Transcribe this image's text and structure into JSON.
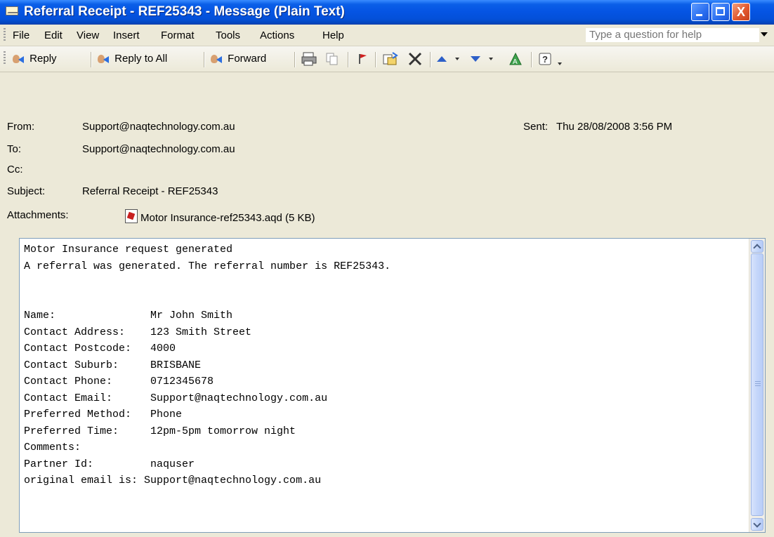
{
  "window": {
    "title": "Referral Receipt - REF25343 - Message (Plain Text)",
    "close_glyph": "X"
  },
  "menu": {
    "items": [
      "File",
      "Edit",
      "View",
      "Insert",
      "Format",
      "Tools",
      "Actions",
      "Help"
    ],
    "help_placeholder": "Type a question for help"
  },
  "toolbar": {
    "reply": "Reply",
    "reply_all": "Reply to All",
    "forward": "Forward"
  },
  "header": {
    "from_label": "From:",
    "from_value": "Support@naqtechnology.com.au",
    "to_label": "To:",
    "to_value": "Support@naqtechnology.com.au",
    "cc_label": "Cc:",
    "subject_label": "Subject:",
    "subject_value": "Referral Receipt - REF25343",
    "sent_label": "Sent:",
    "sent_value": "Thu 28/08/2008 3:56 PM",
    "attachments_label": "Attachments:",
    "attachment_name": "Motor Insurance-ref25343.aqd (5 KB)"
  },
  "body": {
    "lines": [
      "Motor Insurance request generated",
      "A referral was generated. The referral number is REF25343.",
      "",
      "",
      "Name:               Mr John Smith",
      "Contact Address:    123 Smith Street",
      "Contact Postcode:   4000",
      "Contact Suburb:     BRISBANE",
      "Contact Phone:      0712345678",
      "Contact Email:      Support@naqtechnology.com.au",
      "Preferred Method:   Phone",
      "Preferred Time:     12pm-5pm tomorrow night",
      "Comments:",
      "Partner Id:         naquser",
      "original email is: Support@naqtechnology.com.au"
    ]
  },
  "colors": {
    "titlebar": "#0554E3",
    "chrome": "#ECE9D8",
    "close_button": "#E2582E"
  },
  "icons": [
    "envelope-icon",
    "minimize-icon",
    "maximize-icon",
    "close-icon",
    "reply-icon",
    "reply-all-icon",
    "forward-icon",
    "print-icon",
    "copy-icon",
    "flag-icon",
    "move-to-folder-icon",
    "delete-icon",
    "previous-item-icon",
    "next-item-icon",
    "address-book-icon",
    "help-icon",
    "attachment-file-icon"
  ]
}
